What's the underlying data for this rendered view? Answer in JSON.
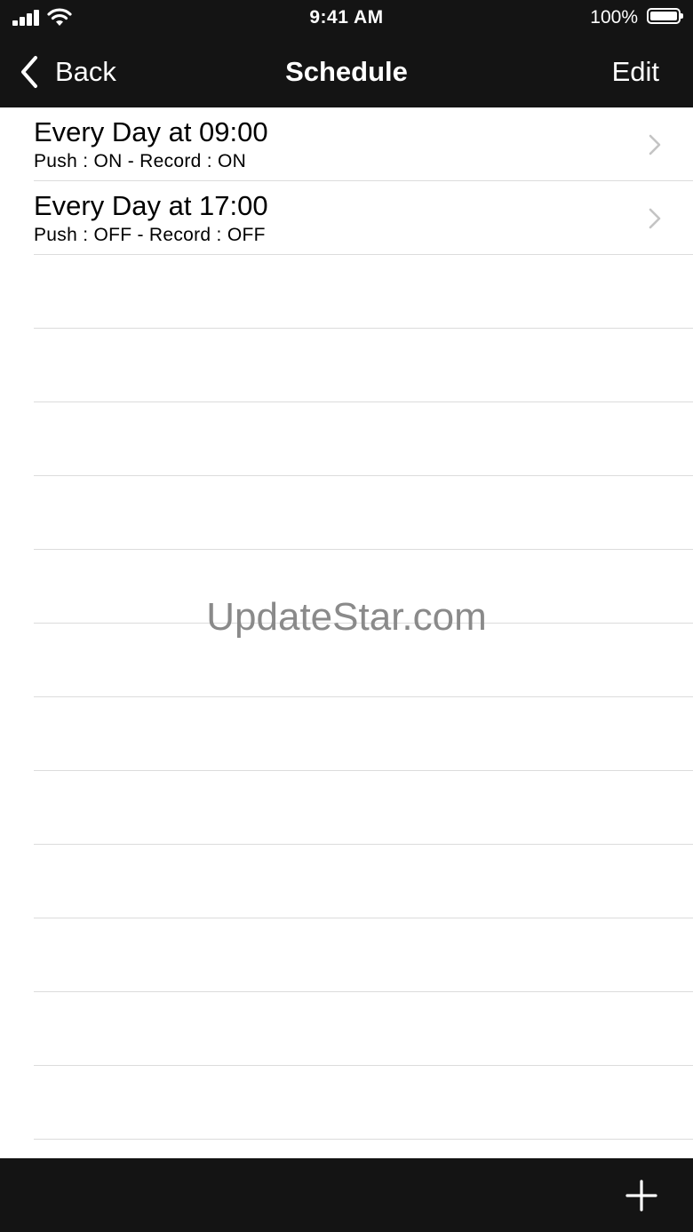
{
  "status_bar": {
    "time": "9:41 AM",
    "battery_percent": "100%",
    "icons": [
      "signal-icon",
      "wifi-icon",
      "battery-icon"
    ]
  },
  "nav": {
    "back_label": "Back",
    "title": "Schedule",
    "edit_label": "Edit",
    "back_icon": "chevron-left-icon"
  },
  "schedules": [
    {
      "title": "Every Day at 09:00",
      "subtitle": "Push : ON - Record : ON"
    },
    {
      "title": "Every Day at 17:00",
      "subtitle": "Push : OFF - Record : OFF"
    }
  ],
  "watermark": "UpdateStar.com",
  "toolbar": {
    "add_icon": "plus-icon"
  },
  "colors": {
    "bar_background": "#141414",
    "separator": "#dcdcdc",
    "chevron": "#c4c4c4"
  }
}
